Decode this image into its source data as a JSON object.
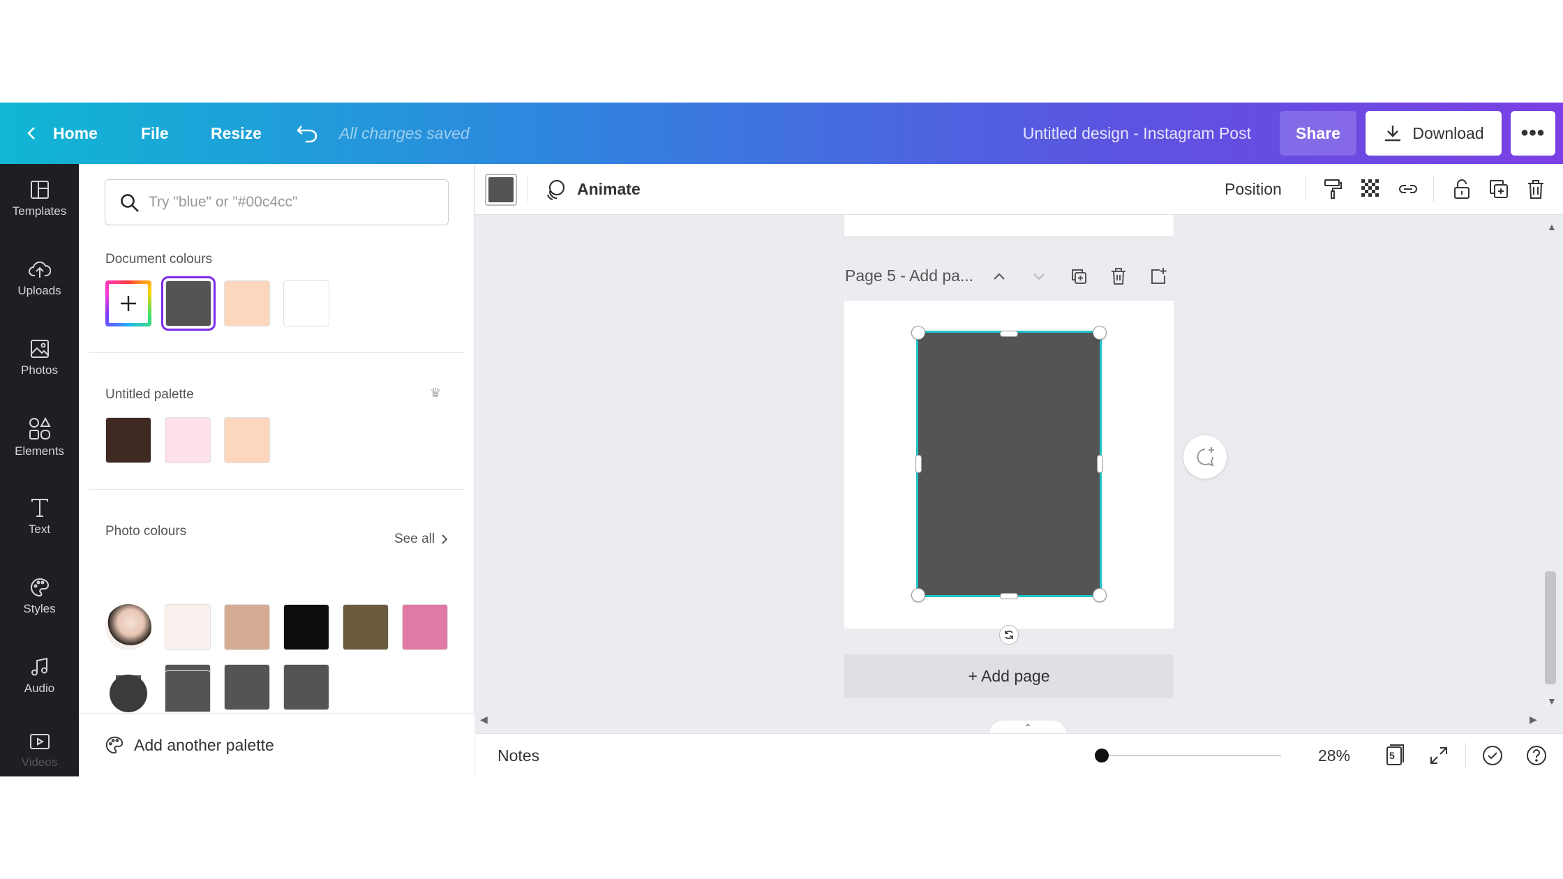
{
  "topbar": {
    "home": "Home",
    "file": "File",
    "resize": "Resize",
    "saved_status": "All changes saved",
    "doc_title": "Untitled design - Instagram Post",
    "share": "Share",
    "download": "Download"
  },
  "rail": {
    "items": [
      {
        "label": "Templates",
        "icon": "templates-icon"
      },
      {
        "label": "Uploads",
        "icon": "upload-cloud-icon"
      },
      {
        "label": "Photos",
        "icon": "image-icon"
      },
      {
        "label": "Elements",
        "icon": "shapes-icon"
      },
      {
        "label": "Text",
        "icon": "text-icon"
      },
      {
        "label": "Styles",
        "icon": "palette-icon"
      },
      {
        "label": "Audio",
        "icon": "music-note-icon"
      },
      {
        "label": "Videos",
        "icon": "video-icon"
      }
    ]
  },
  "panel": {
    "search_placeholder": "Try \"blue\" or \"#00c4cc\"",
    "document_colours_title": "Document colours",
    "document_colours": [
      "#545454",
      "#fcd6bd",
      "#ffffff"
    ],
    "palette_title": "Untitled palette",
    "palette_colours": [
      "#3e2a23",
      "#fde0ea",
      "#fcd6bd"
    ],
    "photo_colours_title": "Photo colours",
    "see_all": "See all",
    "photo_row1": [
      "#545454",
      "#545454",
      "#545454"
    ],
    "photo_row2": [
      "#f9f1ed",
      "#d6ab94",
      "#0d0d0b",
      "#6b5a3e",
      "#e07aa5"
    ],
    "photo_row3": [
      "#545454"
    ],
    "add_palette": "Add another palette"
  },
  "toolbar": {
    "selected_colour": "#545454",
    "animate": "Animate",
    "position": "Position"
  },
  "canvas": {
    "page_label": "Page 5 - Add pa...",
    "add_page": "+ Add page",
    "shape_colour": "#545454",
    "selection_colour": "#20c4cb"
  },
  "bottombar": {
    "notes": "Notes",
    "zoom": "28%",
    "page_count": "5"
  },
  "colors": {
    "accent": "#7d2ae8",
    "rail_bg": "#1e1f23",
    "canvas_bg": "#ebecf0"
  }
}
